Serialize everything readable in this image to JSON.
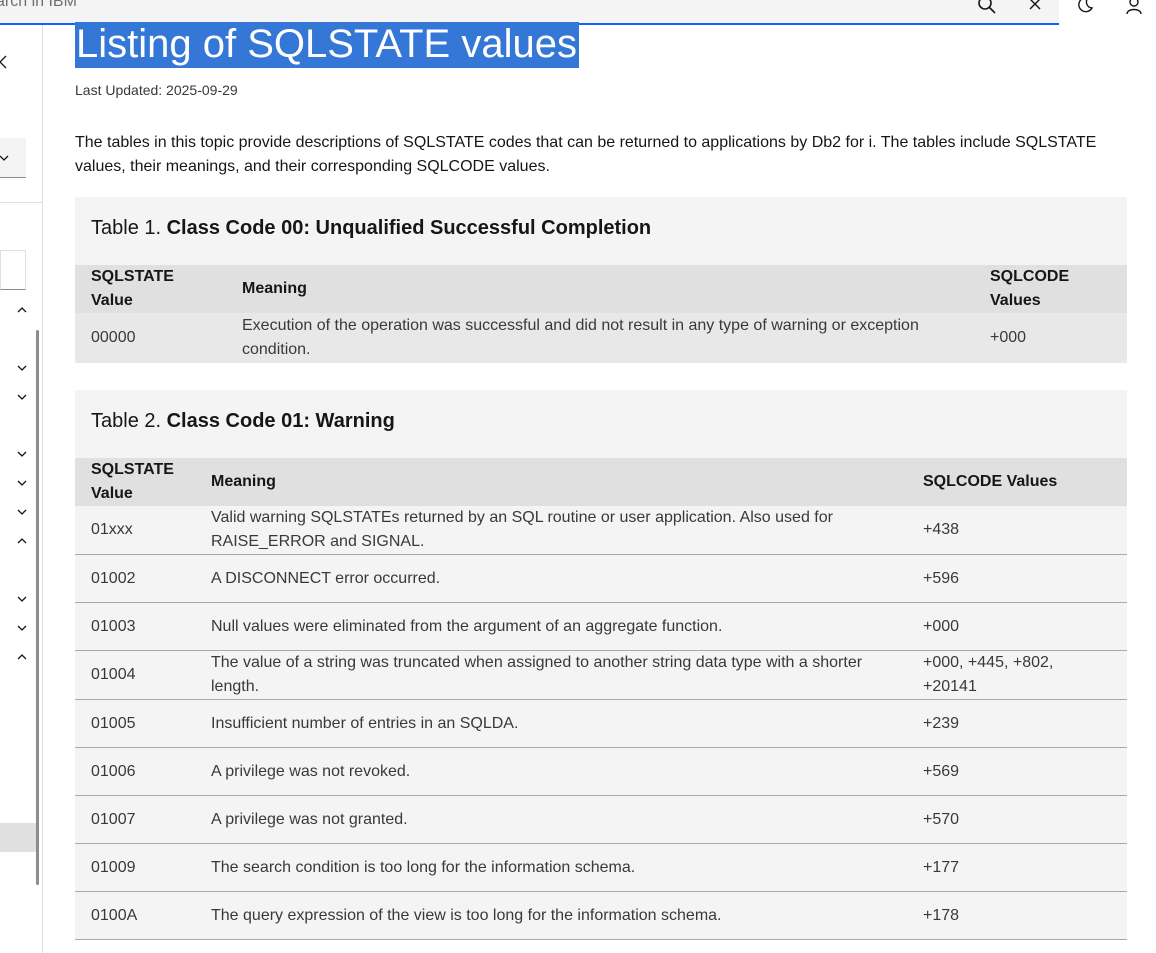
{
  "search": {
    "placeholder_visible_text": "arch in IBM"
  },
  "page": {
    "title": "Listing of SQLSTATE values",
    "last_updated": "Last Updated: 2025-09-29",
    "intro": "The tables in this topic provide descriptions of SQLSTATE codes that can be returned to applications by Db2 for i. The tables include SQLSTATE values, their meanings, and their corresponding SQLCODE values."
  },
  "table1": {
    "caption_prefix": "Table 1. ",
    "caption_title": "Class Code 00: Unqualified Successful Completion",
    "headers": [
      "SQLSTATE Value",
      "Meaning",
      "SQLCODE Values"
    ],
    "rows": [
      [
        "00000",
        "Execution of the operation was successful and did not result in any type of warning or exception condition.",
        "+000"
      ]
    ]
  },
  "table2": {
    "caption_prefix": "Table 2. ",
    "caption_title": "Class Code 01: Warning",
    "headers": [
      "SQLSTATE Value",
      "Meaning",
      "SQLCODE Values"
    ],
    "rows": [
      [
        "01xxx",
        "Valid warning SQLSTATEs returned by an SQL routine or user application. Also used for RAISE_ERROR and SIGNAL.",
        "+438"
      ],
      [
        "01002",
        "A DISCONNECT error occurred.",
        "+596"
      ],
      [
        "01003",
        "Null values were eliminated from the argument of an aggregate function.",
        "+000"
      ],
      [
        "01004",
        "The value of a string was truncated when assigned to another string data type with a shorter length.",
        "+000, +445, +802, +20141"
      ],
      [
        "01005",
        "Insufficient number of entries in an SQLDA.",
        "+239"
      ],
      [
        "01006",
        "A privilege was not revoked.",
        "+569"
      ],
      [
        "01007",
        "A privilege was not granted.",
        "+570"
      ],
      [
        "01009",
        "The search condition is too long for the information schema.",
        "+177"
      ],
      [
        "0100A",
        "The query expression of the view is too long for the information schema.",
        "+178"
      ]
    ]
  },
  "icons": [
    "search-icon",
    "close-icon",
    "moon-icon",
    "user-icon",
    "collapse-icon",
    "chevron-down-icon",
    "chevron-up-icon"
  ],
  "colors": {
    "accent": "#0f62fe",
    "selection": "#3477d6",
    "table_bg": "#f4f4f4",
    "header_bg": "#e0e0e0"
  }
}
